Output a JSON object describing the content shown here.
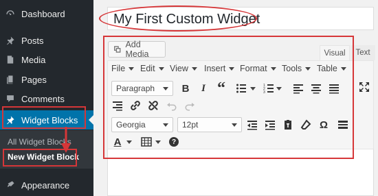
{
  "sidebar": {
    "items": [
      {
        "label": "Dashboard",
        "icon": "dashboard-icon"
      },
      {
        "label": "Posts",
        "icon": "pin-icon"
      },
      {
        "label": "Media",
        "icon": "media-icon"
      },
      {
        "label": "Pages",
        "icon": "pages-icon"
      },
      {
        "label": "Comments",
        "icon": "comments-icon"
      },
      {
        "label": "Widget Blocks",
        "icon": "pin-icon"
      },
      {
        "label": "Appearance",
        "icon": "paintbrush-icon"
      }
    ],
    "submenu": [
      {
        "label": "All Widget Blocks"
      },
      {
        "label": "New Widget Block"
      }
    ]
  },
  "title": {
    "value": "My First Custom Widget"
  },
  "editor": {
    "add_media": "Add Media",
    "tabs": {
      "visual": "Visual",
      "text": "Text"
    },
    "menubar": [
      "File",
      "Edit",
      "View",
      "Insert",
      "Format",
      "Tools",
      "Table"
    ],
    "format_select": "Paragraph",
    "font_family": "Georgia",
    "font_size": "12pt",
    "bold_glyph": "B",
    "italic_glyph": "I",
    "quote_glyph": "“",
    "text_color_glyph": "A",
    "omega_glyph": "Ω",
    "help_glyph": "?"
  },
  "colors": {
    "accent": "#0073aa",
    "annotation": "#d63638",
    "sidebar_bg": "#23282d"
  }
}
